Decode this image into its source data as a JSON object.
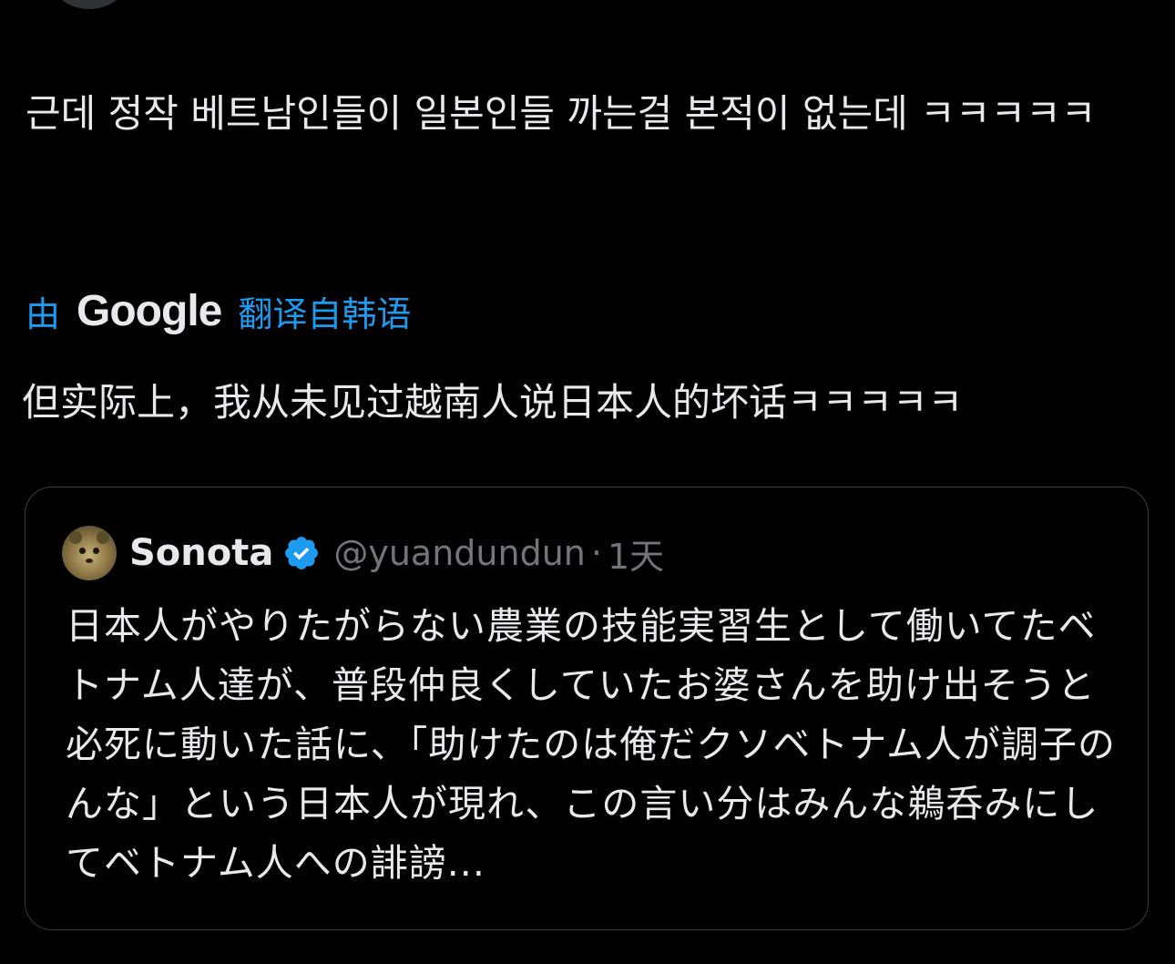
{
  "tweet": {
    "text": "근데 정작 베트남인들이 일본인들 까는걸 본적이 없는데 ㅋㅋㅋㅋㅋ"
  },
  "translation": {
    "prefix": "由",
    "provider": "Google",
    "suffix": "翻译自韩语",
    "text": "但实际上，我从未见过越南人说日本人的坏话ㅋㅋㅋㅋㅋ"
  },
  "quote": {
    "name": "Sonota",
    "handle": "@yuandundun",
    "separator": "·",
    "time": "1天",
    "text": "日本人がやりたがらない農業の技能実習生として働いてたベトナム人達が、普段仲良くしていたお婆さんを助け出そうと必死に動いた話に、「助けたのは俺だクソベトナム人が調子のんな」という日本人が現れ、この言い分はみんな鵜呑みにしてベトナム人への誹謗..."
  },
  "colors": {
    "background": "#000000",
    "text": "#e7e9ea",
    "secondary_text": "#71767b",
    "accent": "#1d9bf0",
    "border": "#3a3d40"
  },
  "icons": {
    "verified": "verified-badge-icon",
    "avatar": "avatar"
  }
}
